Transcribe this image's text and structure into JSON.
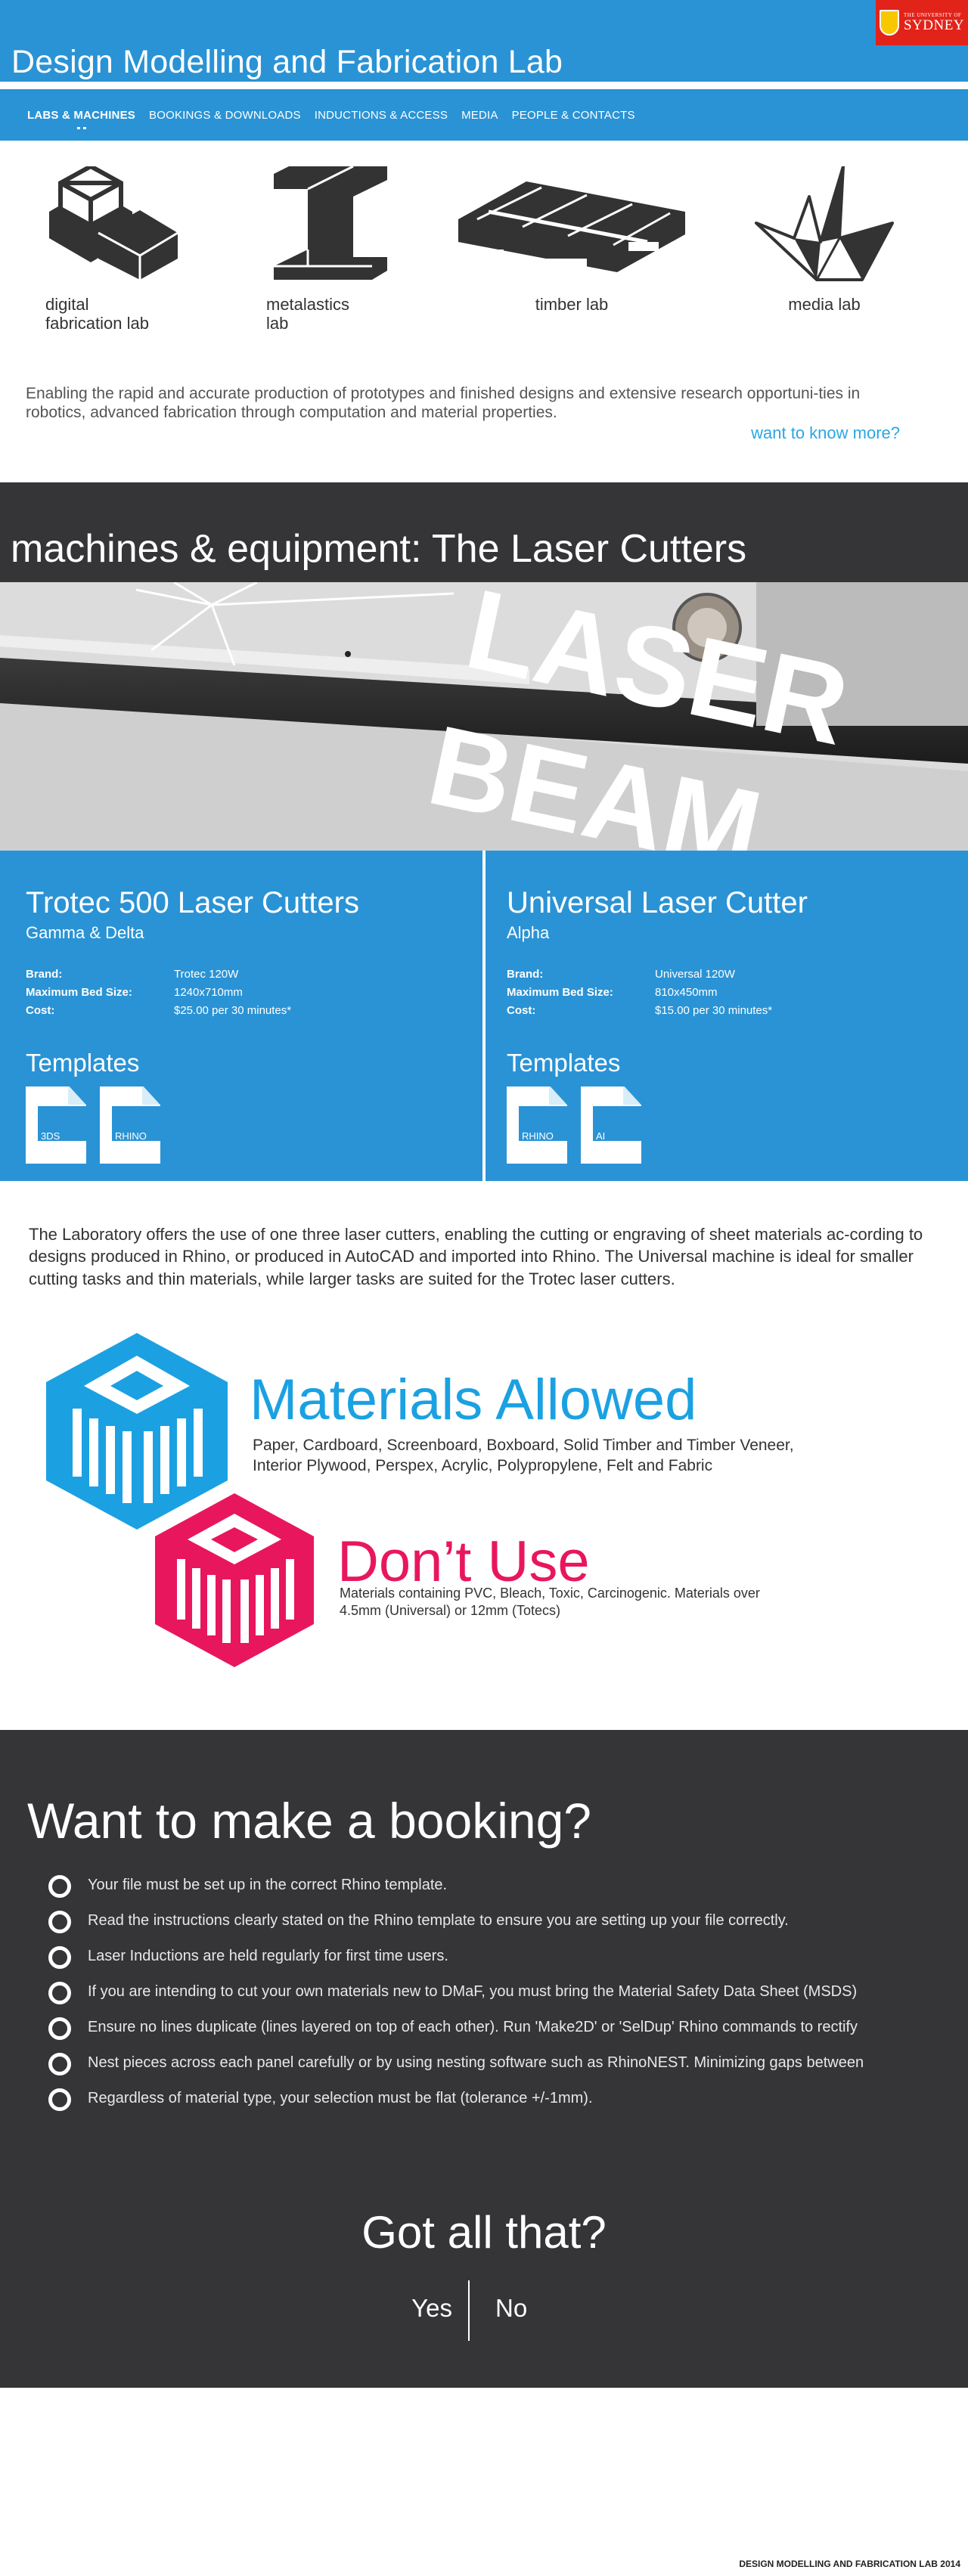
{
  "brand": {
    "small": "THE UNIVERSITY OF",
    "large": "SYDNEY"
  },
  "header": {
    "title": "Design Modelling and Fabrication Lab"
  },
  "nav": [
    {
      "label": "LABS & MACHINES",
      "active": true
    },
    {
      "label": "BOOKINGS & DOWNLOADS"
    },
    {
      "label": "INDUCTIONS & ACCESS"
    },
    {
      "label": "MEDIA"
    },
    {
      "label": "PEOPLE & CONTACTS"
    }
  ],
  "labs": [
    {
      "label": "digital\nfabrication lab",
      "icon": "cube-stack-icon"
    },
    {
      "label": "metalastics\nlab",
      "icon": "i-beam-icon"
    },
    {
      "label": "timber lab",
      "icon": "pallet-icon"
    },
    {
      "label": "media lab",
      "icon": "paper-crane-icon"
    }
  ],
  "intro": {
    "text": "Enabling the rapid and accurate production of prototypes and finished designs and extensive research opportuni-ties in robotics, advanced fabrication through computation and material properties.",
    "link": "want to know more?"
  },
  "section": {
    "title": "machines & equipment: The Laser Cutters"
  },
  "hero": {
    "line1": "LASER",
    "line2": "BEAM"
  },
  "machines": [
    {
      "name": "Trotec 500 Laser Cutters",
      "sub": "Gamma & Delta",
      "specs": [
        {
          "k": "Brand:",
          "v": "Trotec 120W"
        },
        {
          "k": "Maximum Bed Size:",
          "v": "1240x710mm"
        },
        {
          "k": "Cost:",
          "v": "$25.00 per 30 minutes*"
        }
      ],
      "templates_title": "Templates",
      "templates": [
        "3DS",
        "RHINO"
      ]
    },
    {
      "name": "Universal Laser Cutter",
      "sub": "Alpha",
      "specs": [
        {
          "k": "Brand:",
          "v": "Universal 120W"
        },
        {
          "k": "Maximum Bed Size:",
          "v": "810x450mm"
        },
        {
          "k": "Cost:",
          "v": "$15.00 per 30 minutes*"
        }
      ],
      "templates_title": "Templates",
      "templates": [
        "RHINO",
        "AI"
      ]
    }
  ],
  "description": "The Laboratory offers the use of one three laser cutters, enabling the cutting or engraving of sheet materials ac-cording to designs produced in Rhino, or produced in AutoCAD and imported into Rhino. The Universal machine is ideal for smaller cutting tasks and thin materials, while larger tasks are suited for the Trotec laser cutters.",
  "materials": {
    "allowed_title": "Materials Allowed",
    "allowed_text": "Paper, Cardboard, Screenboard, Boxboard, Solid Timber and Timber Veneer, Interior Plywood, Perspex, Acrylic, Polypropylene, Felt and Fabric",
    "dont_title": "Don’t Use",
    "dont_text": "Materials containing PVC, Bleach, Toxic, Carcinogenic. Materials over 4.5mm (Universal) or 12mm (Totecs)",
    "colors": {
      "allowed": "#1ba1e2",
      "dont": "#e8175d"
    }
  },
  "booking": {
    "title": "Want to make a booking?",
    "rules": [
      "Your file must be set up in the correct Rhino template.",
      "Read the instructions clearly stated on the Rhino template to ensure you are setting up your file correctly.",
      "Laser Inductions are held regularly for first time users.",
      "If you are intending to cut your own materials new to DMaF, you must bring the Material Safety Data Sheet (MSDS)",
      "Ensure no lines duplicate (lines layered on top of each other). Run 'Make2D' or 'SelDup' Rhino commands to rectify",
      "Nest pieces across each panel carefully or by using nesting software such as RhinoNEST. Minimizing gaps between",
      "Regardless of material type, your selection must be flat (tolerance +/-1mm)."
    ],
    "question": "Got all that?",
    "yes": "Yes",
    "no": "No"
  },
  "footer": "DESIGN MODELLING AND FABRICATION LAB 2014"
}
